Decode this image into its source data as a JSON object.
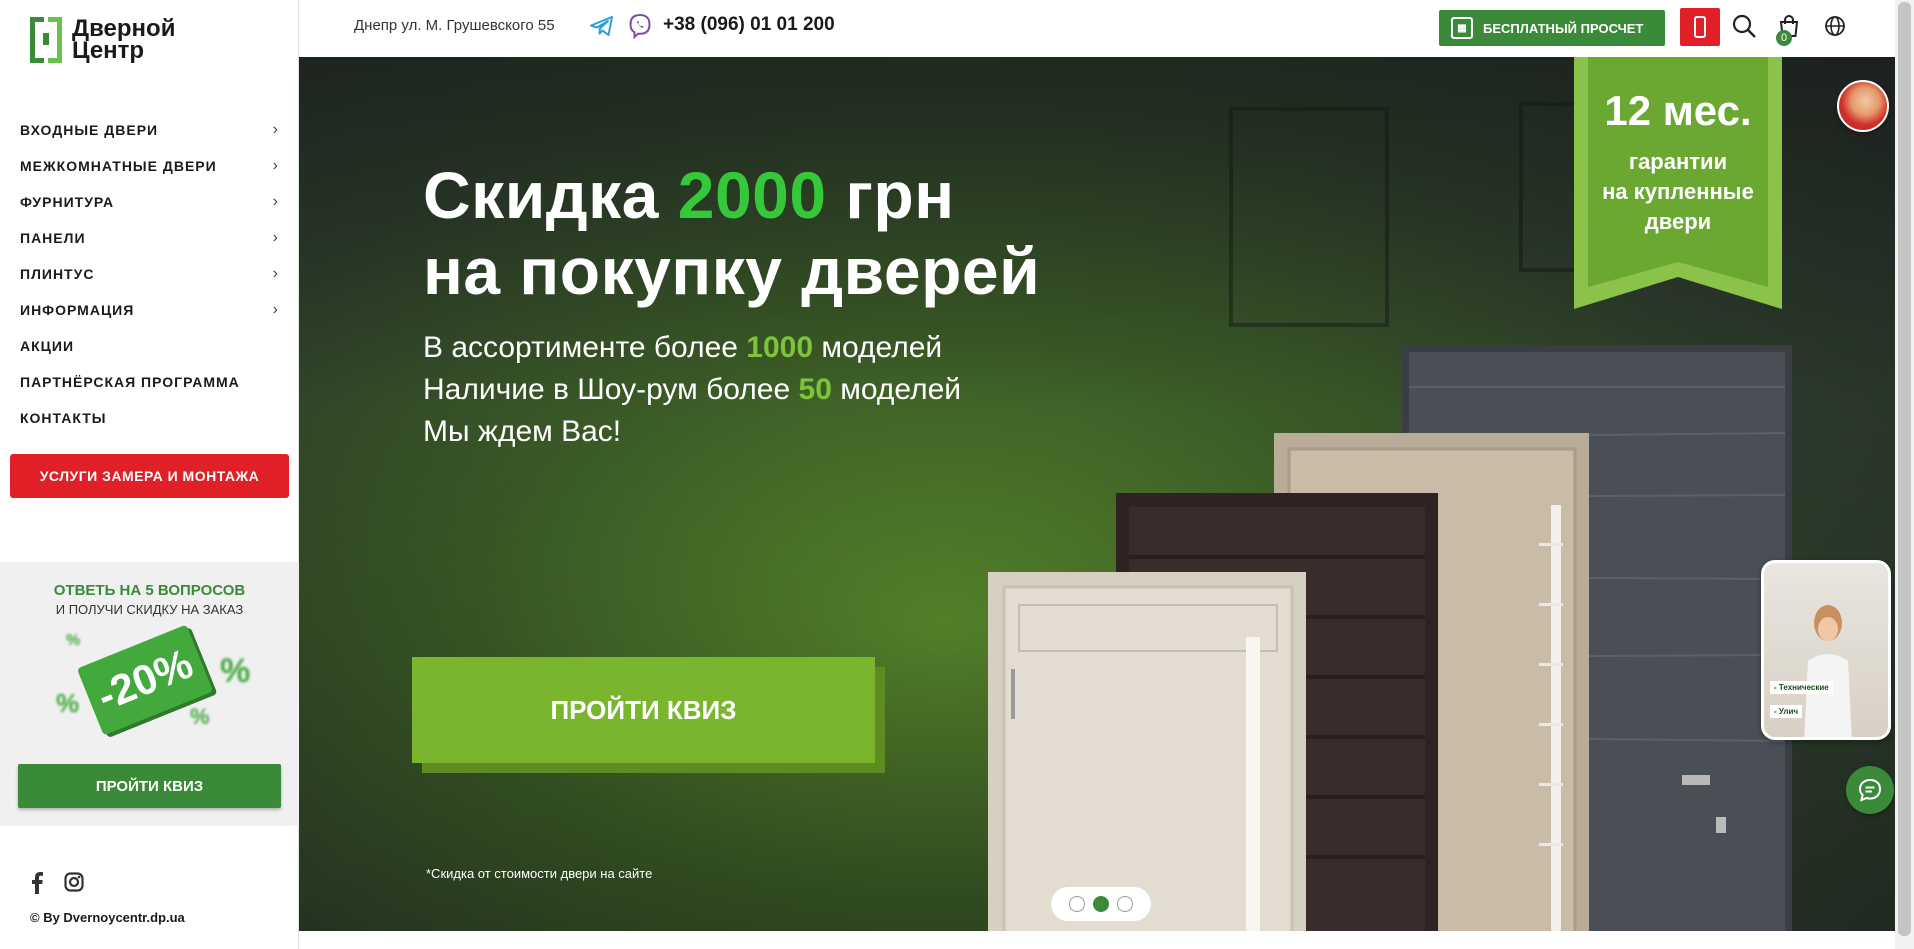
{
  "brand": {
    "line1": "Дверной",
    "line2": "Центр"
  },
  "sidebar": {
    "menu": [
      {
        "label": "ВХОДНЫЕ ДВЕРИ",
        "has_submenu": true
      },
      {
        "label": "МЕЖКОМНАТНЫЕ ДВЕРИ",
        "has_submenu": true
      },
      {
        "label": "ФУРНИТУРА",
        "has_submenu": true
      },
      {
        "label": "ПАНЕЛИ",
        "has_submenu": true
      },
      {
        "label": "ПЛИНТУС",
        "has_submenu": true
      },
      {
        "label": "ИНФОРМАЦИЯ",
        "has_submenu": true
      },
      {
        "label": "АКЦИИ",
        "has_submenu": false
      },
      {
        "label": "ПАРТНЁРСКАЯ ПРОГРАММА",
        "has_submenu": false
      },
      {
        "label": "КОНТАКТЫ",
        "has_submenu": false
      }
    ],
    "services_button": "УСЛУГИ ЗАМЕРА И МОНТАЖА",
    "quiz": {
      "title": "ОТВЕТЬ НА 5 ВОПРОСОВ",
      "subtitle": "И ПОЛУЧИ СКИДКУ НА ЗАКАЗ",
      "discount": "-20%",
      "button": "ПРОЙТИ КВИЗ"
    },
    "socials": [
      "facebook-icon",
      "instagram-icon"
    ],
    "copyright": "© By Dvernoycentr.dp.ua"
  },
  "header": {
    "address": "Днепр ул. М. Грушевского 55",
    "phone": "+38 (096) 01 01 200",
    "calc_button": "БЕСПЛАТНЫЙ ПРОСЧЕТ",
    "cart_count": "0",
    "icons": [
      "telegram-icon",
      "viber-icon",
      "calculator-icon",
      "mobile-icon",
      "search-icon",
      "cart-icon",
      "globe-icon"
    ]
  },
  "hero": {
    "headline_prefix": "Скидка ",
    "headline_amount": "2000",
    "headline_suffix": " грн",
    "headline_line2": "на покупку дверей",
    "line1_prefix": "В ассортименте более ",
    "line1_num": "1000",
    "line1_suffix": " моделей",
    "line2_prefix": "Наличие в Шоу-рум более ",
    "line2_num": "50",
    "line2_suffix": " моделей",
    "line3": "Мы ждем Вас!",
    "cta": "ПРОЙТИ КВИЗ",
    "footnote": "*Скидка от стоимости двери на сайте",
    "ribbon_big": "12 мес.",
    "ribbon_l1": "гарантии",
    "ribbon_l2": "на купленные",
    "ribbon_l3": "двери",
    "slides": 3,
    "active_slide": 2
  },
  "widgets": {
    "video_caption1": "- Технические",
    "video_caption2": "- Улич"
  },
  "colors": {
    "green": "#3a8a3a",
    "light_green": "#7ab52e",
    "red": "#e01f26"
  }
}
